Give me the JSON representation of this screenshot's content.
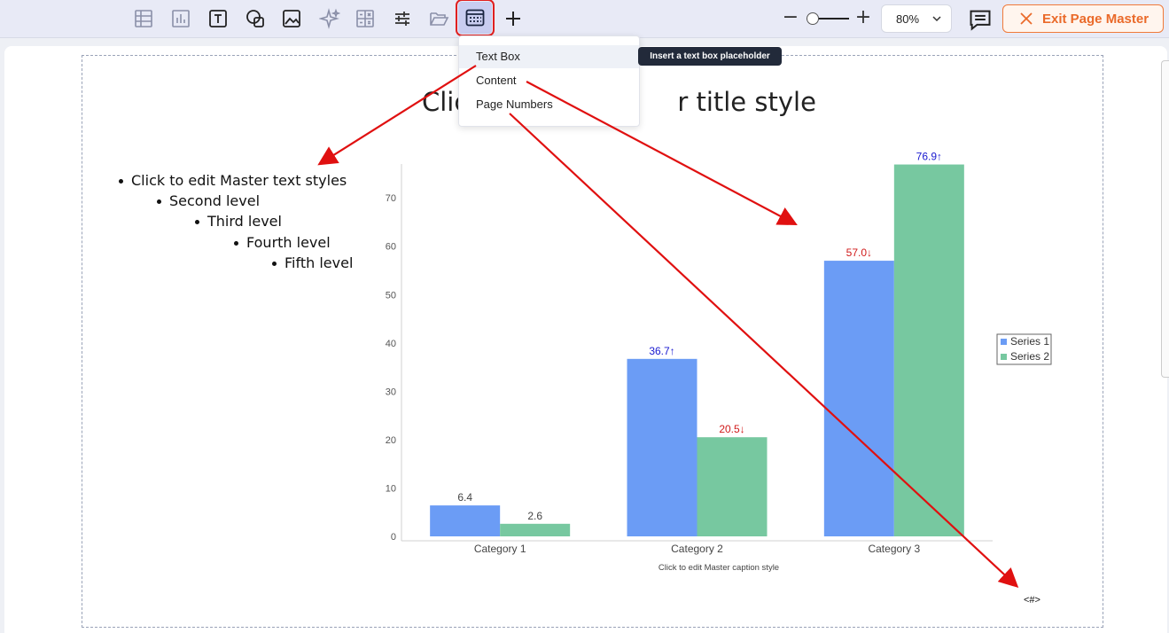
{
  "toolbar": {
    "tools": [
      {
        "name": "table-icon"
      },
      {
        "name": "chart-icon"
      },
      {
        "name": "text-icon"
      },
      {
        "name": "shapes-icon"
      },
      {
        "name": "image-icon"
      },
      {
        "name": "ai-sparkle-icon"
      },
      {
        "name": "formula-icon"
      },
      {
        "name": "adjust-icon"
      },
      {
        "name": "folder-open-icon"
      },
      {
        "name": "placeholder-icon",
        "active": true
      },
      {
        "name": "plus-icon"
      }
    ],
    "zoom_value": "80%",
    "exit_label": "Exit Page Master",
    "accent": "#ea6a2a"
  },
  "menu": {
    "items": [
      {
        "label": "Text Box"
      },
      {
        "label": "Content"
      },
      {
        "label": "Page Numbers"
      }
    ],
    "tooltip": "Insert a text box placeholder"
  },
  "slide": {
    "title": "Click to edit Master title style",
    "visible_title_fragment_left": "Clic",
    "visible_title_fragment_right": "r title style",
    "bullets": [
      "Click to edit Master text styles",
      "Second level",
      "Third level",
      "Fourth level",
      "Fifth level"
    ],
    "page_number": "<#>"
  },
  "chart_data": {
    "type": "bar",
    "categories": [
      "Category 1",
      "Category 2",
      "Category 3"
    ],
    "series": [
      {
        "name": "Series 1",
        "color": "#6b9cf5",
        "values": [
          6.4,
          36.7,
          57.0
        ],
        "labels": [
          "6.4",
          "36.7↑",
          "57.0↓"
        ]
      },
      {
        "name": "Series 2",
        "color": "#77c8a0",
        "values": [
          2.6,
          20.5,
          76.9
        ],
        "labels": [
          "2.6",
          "20.5↓",
          "76.9↑"
        ]
      }
    ],
    "label_colors": [
      [
        "#444444",
        "#444444"
      ],
      [
        "#1a1ad0",
        "#d01a1a"
      ],
      [
        "#d01a1a",
        "#1a1ad0"
      ]
    ],
    "yticks": [
      0,
      10,
      20,
      30,
      40,
      50,
      60,
      70
    ],
    "ylim": [
      0,
      77
    ],
    "caption": "Click to edit Master caption style",
    "legend": "right"
  }
}
